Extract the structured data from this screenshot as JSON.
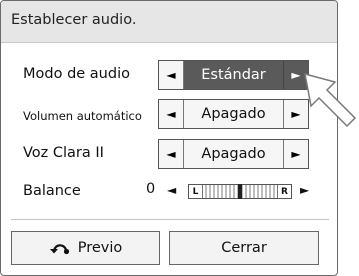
{
  "dialog": {
    "title": "Establecer audio."
  },
  "rows": [
    {
      "label": "Modo de audio",
      "value": "Estándar"
    },
    {
      "label": "Volumen automático",
      "value": "Apagado"
    },
    {
      "label": "Voz Clara II",
      "value": "Apagado"
    }
  ],
  "balance": {
    "label": "Balance",
    "value": "0",
    "left_label": "L",
    "right_label": "R",
    "level_fraction": 0.5
  },
  "arrows": {
    "left": "◄",
    "right": "►"
  },
  "buttons": {
    "previous_label": "Previo",
    "close_label": "Cerrar"
  },
  "icons": {
    "back": "back-arrow-icon",
    "cursor": "mouse-pointer-icon"
  },
  "colors": {
    "selected_bg": "#5a5a5a",
    "titlebar_bg": "#e6e6e6",
    "border": "#555555"
  }
}
